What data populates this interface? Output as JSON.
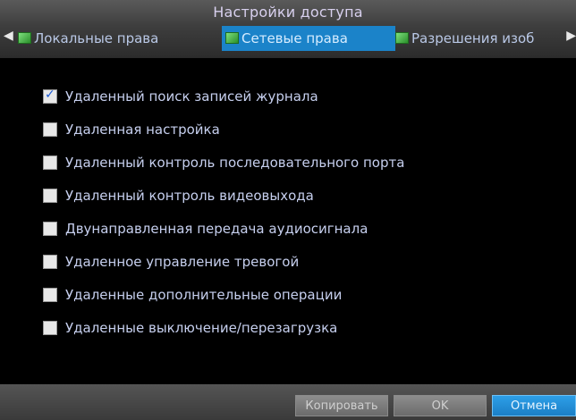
{
  "window": {
    "title": "Настройки доступа"
  },
  "tabs": [
    {
      "label": "Локальные права",
      "active": false
    },
    {
      "label": "Сетевые права",
      "active": true
    },
    {
      "label": "Разрешения изоб",
      "active": false
    }
  ],
  "permissions": [
    {
      "label": "Удаленный поиск записей журнала",
      "checked": true
    },
    {
      "label": "Удаленная настройка",
      "checked": false
    },
    {
      "label": "Удаленный контроль последовательного порта",
      "checked": false
    },
    {
      "label": "Удаленный контроль видеовыхода",
      "checked": false
    },
    {
      "label": "Двунаправленная передача аудиосигнала",
      "checked": false
    },
    {
      "label": "Удаленное управление тревогой",
      "checked": false
    },
    {
      "label": "Удаленные дополнительные операции",
      "checked": false
    },
    {
      "label": "Удаленные выключение/перезагрузка",
      "checked": false
    }
  ],
  "footer": {
    "copy_label": "Копировать",
    "ok_label": "OK",
    "cancel_label": "Отмена"
  },
  "colors": {
    "accent": "#1b83c9",
    "text": "#c6cfee"
  },
  "icons": {
    "tab_icon": "green-square-icon",
    "left_arrow": "triangle-left-icon",
    "right_arrow": "triangle-right-icon"
  }
}
